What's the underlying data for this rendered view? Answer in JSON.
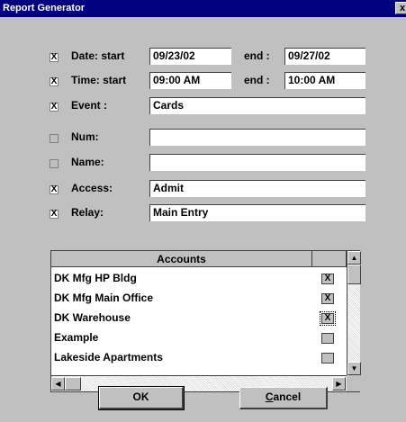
{
  "window": {
    "title": "Report Generator",
    "close_glyph": "x"
  },
  "fields": {
    "date": {
      "checked": true,
      "label": "Date: start",
      "start": "09/23/02",
      "end_label": "end :",
      "end": "09/27/02"
    },
    "time": {
      "checked": true,
      "label": "Time: start",
      "start": "09:00 AM",
      "end_label": "end :",
      "end": "10:00 AM"
    },
    "event": {
      "checked": true,
      "label": "Event :",
      "value": "Cards"
    },
    "num": {
      "checked": false,
      "label": "Num:",
      "value": ""
    },
    "name": {
      "checked": false,
      "label": "Name:",
      "value": ""
    },
    "access": {
      "checked": true,
      "label": "Access:",
      "value": "Admit"
    },
    "relay": {
      "checked": true,
      "label": "Relay:",
      "value": "Main Entry"
    }
  },
  "accounts": {
    "header": "Accounts",
    "rows": [
      {
        "name": "DK Mfg HP Bldg",
        "checked": true,
        "mark": "X"
      },
      {
        "name": "DK Mfg Main Office",
        "checked": true,
        "mark": "X"
      },
      {
        "name": "DK Warehouse",
        "checked": true,
        "mark": "X"
      },
      {
        "name": "Example",
        "checked": false,
        "mark": ""
      },
      {
        "name": "Lakeside Apartments",
        "checked": false,
        "mark": ""
      }
    ]
  },
  "buttons": {
    "ok": "OK",
    "cancel_prefix": "C",
    "cancel_rest": "ancel"
  },
  "colors": {
    "titlebar": "#000080",
    "face": "#c0c0c0",
    "field": "#ffffff"
  },
  "icons": {
    "scroll_up": "▲",
    "scroll_down": "▼",
    "scroll_left": "◀",
    "scroll_right": "▶",
    "check_mark": "X"
  }
}
